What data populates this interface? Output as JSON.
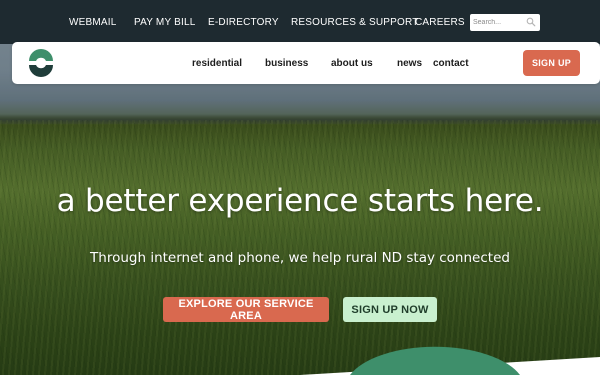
{
  "topbar": {
    "links": [
      "WEBMAIL",
      "PAY MY BILL",
      "E-DIRECTORY",
      "RESOURCES & SUPPORT",
      "CAREERS"
    ],
    "search_placeholder": "Search..."
  },
  "mainnav": {
    "links": [
      "residential",
      "business",
      "about us",
      "news",
      "contact"
    ],
    "signup_label": "SIGN UP"
  },
  "hero": {
    "headline": "a better experience starts here.",
    "subheadline": "Through internet and phone, we help rural ND stay connected",
    "primary_button": "EXPLORE OUR SERVICE AREA",
    "secondary_button": "SIGN UP NOW"
  },
  "colors": {
    "topbar_bg": "#1e2a30",
    "accent_orange": "#d9694f",
    "accent_mint": "#c9f0cf",
    "brand_green": "#3e8f6b",
    "brand_dark": "#1f3d3a"
  },
  "icons": {
    "search": "search-icon",
    "logo": "logo-icon"
  }
}
